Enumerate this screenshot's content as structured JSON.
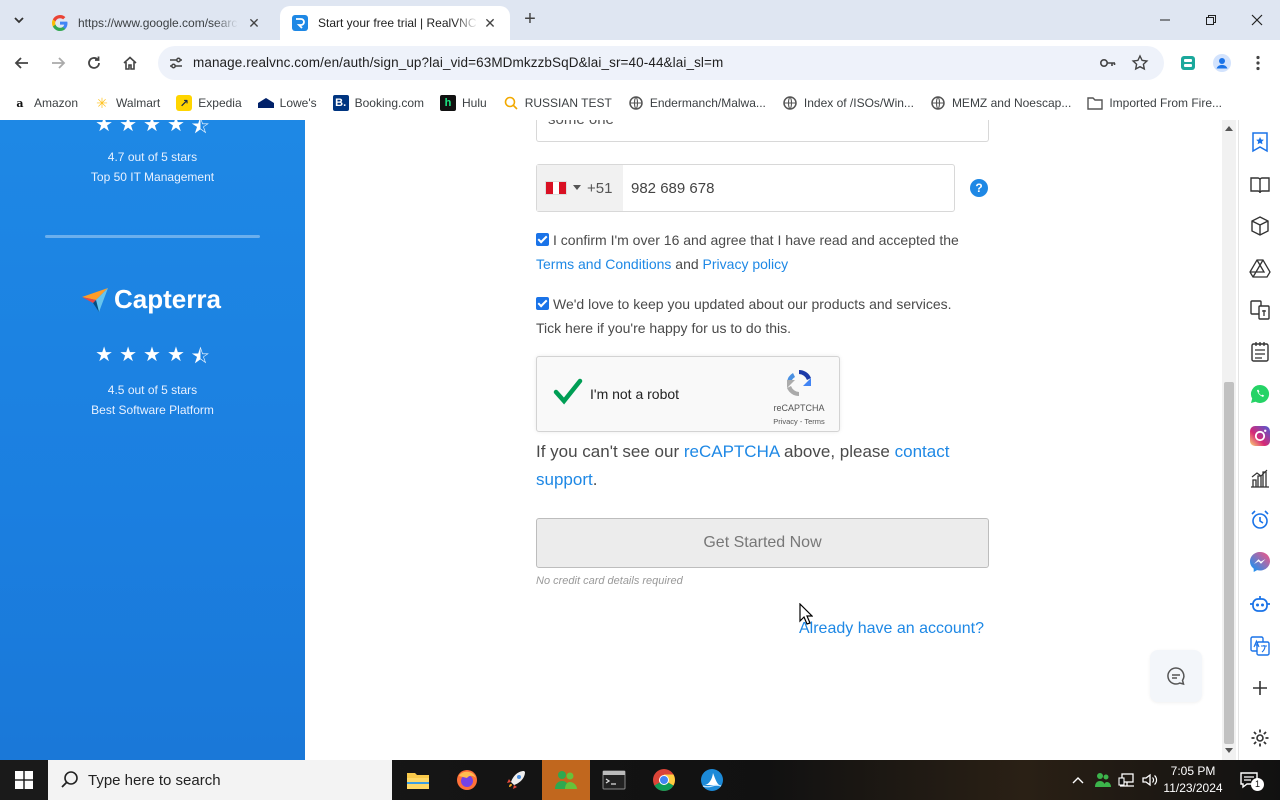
{
  "browser": {
    "tabs": [
      {
        "title": "https://www.google.com/search",
        "favicon": "google-icon"
      },
      {
        "title": "Start your free trial | RealVNC C",
        "favicon": "realvnc-icon"
      }
    ],
    "url": "manage.realvnc.com/en/auth/sign_up?lai_vid=63MDmkzzbSqD&lai_sr=40-44&lai_sl=m",
    "bookmarks": [
      {
        "label": "Amazon",
        "icon": "amazon-icon"
      },
      {
        "label": "Walmart",
        "icon": "walmart-icon"
      },
      {
        "label": "Expedia",
        "icon": "expedia-icon"
      },
      {
        "label": "Lowe's",
        "icon": "lowes-icon"
      },
      {
        "label": "Booking.com",
        "icon": "booking-icon"
      },
      {
        "label": "Hulu",
        "icon": "hulu-icon"
      },
      {
        "label": "RUSSIAN TEST",
        "icon": "search-icon"
      },
      {
        "label": "Endermanch/Malwa...",
        "icon": "globe-icon"
      },
      {
        "label": "Index of /ISOs/Win...",
        "icon": "globe-icon"
      },
      {
        "label": "MEMZ and Noescap...",
        "icon": "globe-icon"
      },
      {
        "label": "Imported From Fire...",
        "icon": "folder-icon"
      }
    ]
  },
  "reviews": {
    "first": {
      "rating": "4.7 out of 5 stars",
      "category": "Top 50 IT Management"
    },
    "capterra": {
      "brand": "Capterra",
      "rating": "4.5 out of 5 stars",
      "category": "Best Software Platform"
    }
  },
  "form": {
    "name_value": "some one",
    "phone": {
      "country_code": "+51",
      "number": "982 689 678",
      "flag": "peru"
    },
    "help_glyph": "?",
    "consent1": {
      "text": "I confirm I'm over 16 and agree that I have read and accepted the",
      "terms": "Terms and Conditions",
      "and": "and",
      "privacy": "Privacy policy",
      "checked": true
    },
    "consent2": {
      "line1": "We'd love to keep you updated about our products and services.",
      "line2": "Tick here if you're happy for us to do this.",
      "checked": true
    },
    "recaptcha": {
      "label": "I'm not a robot",
      "brand": "reCAPTCHA",
      "links": "Privacy - Terms",
      "verified": true
    },
    "cant_see": {
      "prefix": "If you can't see our",
      "recaptcha_link": "reCAPTCHA",
      "middle": "above, please",
      "support_link": "contact support",
      "suffix": "."
    },
    "submit_label": "Get Started Now",
    "no_credit_card": "No credit card details required",
    "already_account": "Already have an account?"
  },
  "taskbar": {
    "search_placeholder": "Type here to search",
    "time": "7:05 PM",
    "date": "11/23/2024",
    "notification_count": "1"
  },
  "colors": {
    "brand_blue": "#1e88e5",
    "panel_blue": "#1b7fe0",
    "link": "#1e88e5"
  }
}
